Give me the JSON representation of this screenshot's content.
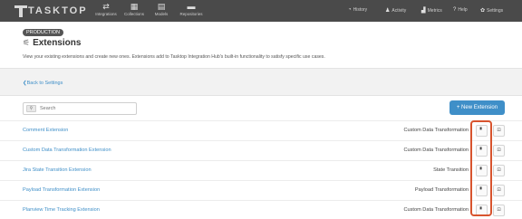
{
  "nav": {
    "logo": "TASKTOP",
    "items": [
      {
        "label": "Integrations",
        "icon": "integrations-icon",
        "glyph": "⇄"
      },
      {
        "label": "Collections",
        "icon": "collections-icon",
        "glyph": "▦"
      },
      {
        "label": "Models",
        "icon": "models-icon",
        "glyph": "▤"
      },
      {
        "label": "Repositories",
        "icon": "repositories-icon",
        "glyph": "▬"
      }
    ],
    "right": [
      {
        "label": "History",
        "icon": "history-icon",
        "glyph": "◔"
      },
      {
        "label": "Activity",
        "icon": "activity-icon",
        "glyph": "♟"
      },
      {
        "label": "Metrics",
        "icon": "metrics-icon",
        "glyph": "▟"
      },
      {
        "label": "Help",
        "icon": "help-icon",
        "glyph": "?"
      },
      {
        "label": "Settings",
        "icon": "settings-icon",
        "glyph": "✿"
      }
    ]
  },
  "header": {
    "badge": "PRODUCTION",
    "title": "Extensions",
    "title_icon": "extensions-icon",
    "subtitle": "View your existing extensions and create new ones. Extensions add to Tasktop Integration Hub's built-in functionality to satisfy specific use cases."
  },
  "back_link": "Back to Settings",
  "search": {
    "placeholder": "Search"
  },
  "new_button": "+ New Extension",
  "extensions": [
    {
      "name": "Comment Extension",
      "type": "Custom Data Transformation"
    },
    {
      "name": "Custom Data Transformation Extension",
      "type": "Custom Data Transformation"
    },
    {
      "name": "Jira State Transition Extension",
      "type": "State Transition"
    },
    {
      "name": "Payload Transformation Extension",
      "type": "Payload Transformation"
    },
    {
      "name": "Planview Time Tracking Extension",
      "type": "Custom Data Transformation"
    }
  ],
  "row_actions": {
    "copy_icon": "copy-icon",
    "delete_icon": "trash-icon",
    "copy_glyph": "▘",
    "delete_glyph": "⊡"
  },
  "colors": {
    "link": "#3f8fc8",
    "primary_button": "#3f8fc8",
    "highlight": "#d8542e",
    "nav_bg": "#4a4a4a"
  }
}
